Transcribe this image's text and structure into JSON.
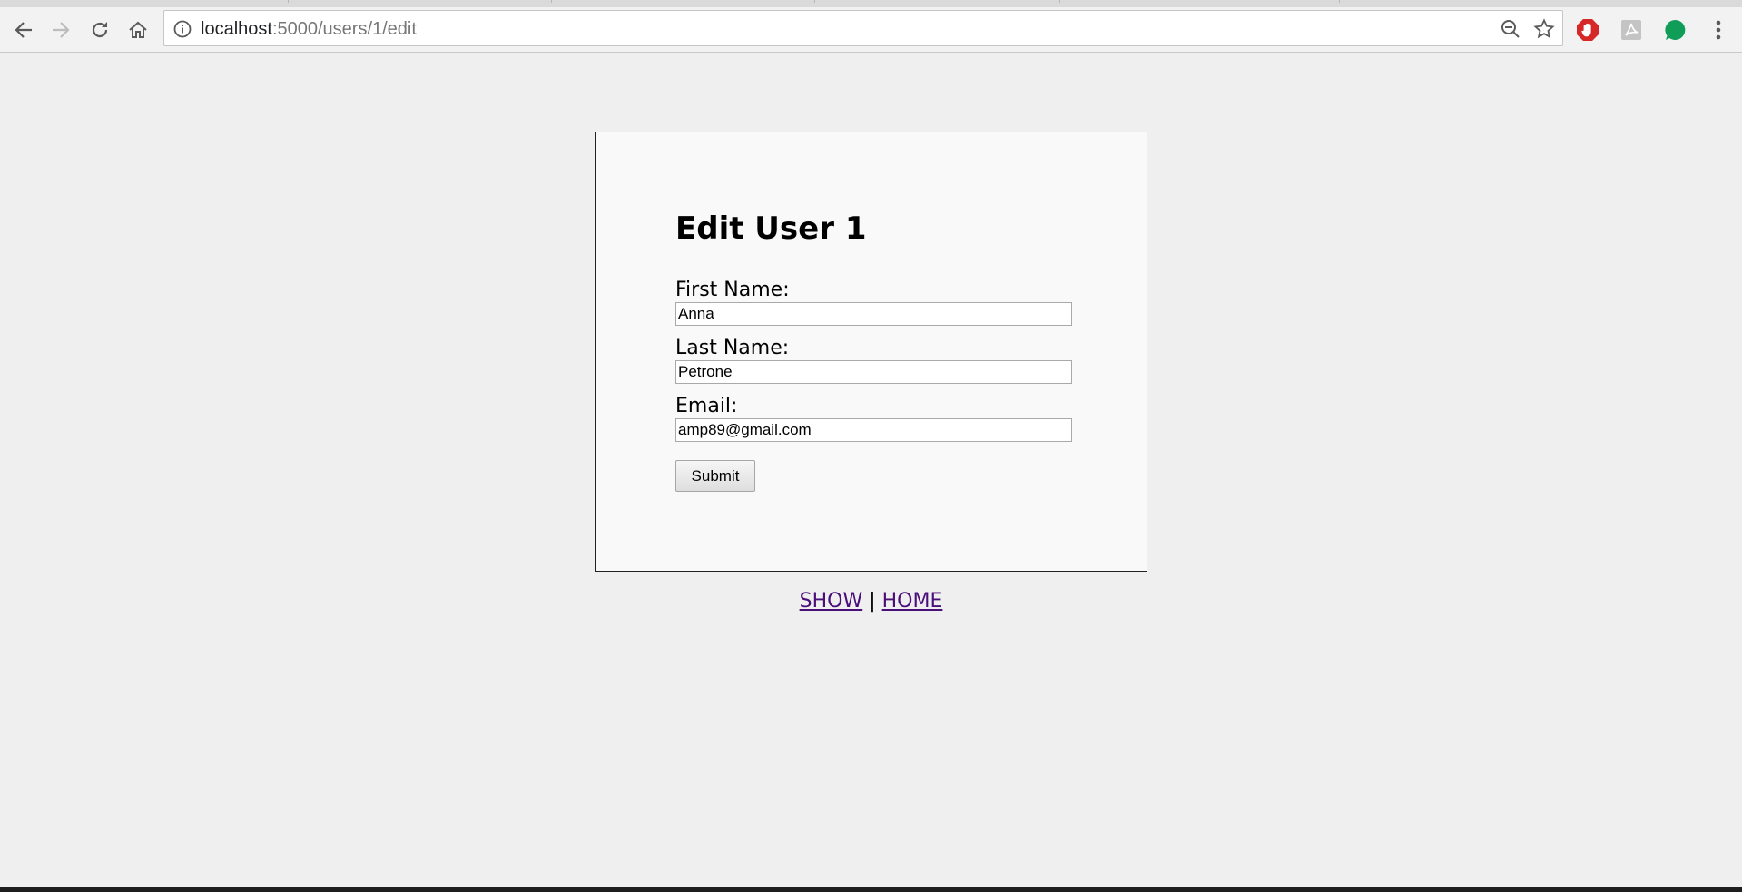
{
  "browser": {
    "url_host": "localhost",
    "url_path": ":5000/users/1/edit"
  },
  "page": {
    "title": "Edit User 1",
    "fields": [
      {
        "label": "First Name:",
        "value": "Anna"
      },
      {
        "label": "Last Name:",
        "value": "Petrone"
      },
      {
        "label": "Email:",
        "value": "amp89@gmail.com"
      }
    ],
    "submit_label": "Submit",
    "links": {
      "show": "SHOW",
      "separator": "|",
      "home": "HOME"
    }
  },
  "colors": {
    "page_background": "#efefef",
    "card_background": "#f9f9f9",
    "visited_link": "#4b0f7a",
    "adblock_red": "#d62828",
    "extension_green": "#0f9d58"
  }
}
